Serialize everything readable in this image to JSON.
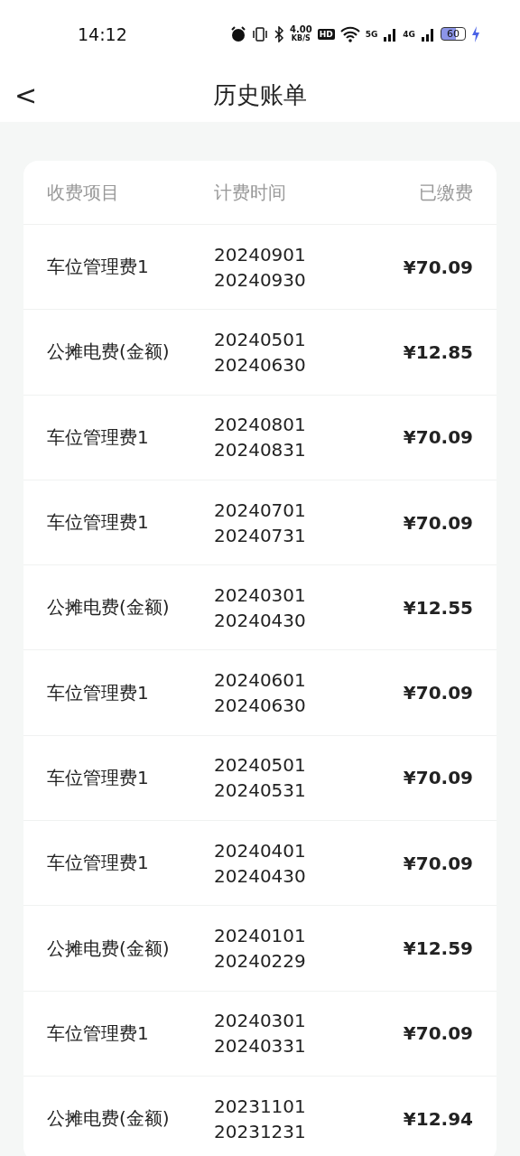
{
  "status_bar": {
    "time": "14:12",
    "speed": "4.00",
    "speed_unit": "KB/S",
    "hd": "HD",
    "network_1": "5G",
    "network_2": "4G",
    "battery": "60"
  },
  "header": {
    "back": "<",
    "title": "历史账单"
  },
  "table": {
    "columns": [
      "收费项目",
      "计费时间",
      "已缴费"
    ],
    "rows": [
      {
        "item": "车位管理费1",
        "start": "20240901",
        "end": "20240930",
        "paid": "¥70.09"
      },
      {
        "item": "公摊电费(金额)",
        "start": "20240501",
        "end": "20240630",
        "paid": "¥12.85"
      },
      {
        "item": "车位管理费1",
        "start": "20240801",
        "end": "20240831",
        "paid": "¥70.09"
      },
      {
        "item": "车位管理费1",
        "start": "20240701",
        "end": "20240731",
        "paid": "¥70.09"
      },
      {
        "item": "公摊电费(金额)",
        "start": "20240301",
        "end": "20240430",
        "paid": "¥12.55"
      },
      {
        "item": "车位管理费1",
        "start": "20240601",
        "end": "20240630",
        "paid": "¥70.09"
      },
      {
        "item": "车位管理费1",
        "start": "20240501",
        "end": "20240531",
        "paid": "¥70.09"
      },
      {
        "item": "车位管理费1",
        "start": "20240401",
        "end": "20240430",
        "paid": "¥70.09"
      },
      {
        "item": "公摊电费(金额)",
        "start": "20240101",
        "end": "20240229",
        "paid": "¥12.59"
      },
      {
        "item": "车位管理费1",
        "start": "20240301",
        "end": "20240331",
        "paid": "¥70.09"
      },
      {
        "item": "公摊电费(金额)",
        "start": "20231101",
        "end": "20231231",
        "paid": "¥12.94"
      }
    ]
  }
}
